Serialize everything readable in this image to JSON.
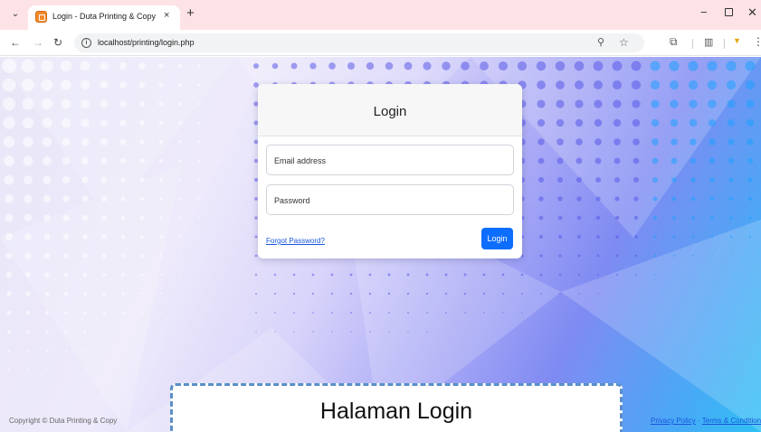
{
  "browser": {
    "tab_title": "Login - Duta Printing & Copy",
    "tab_close": "×",
    "new_tab": "+",
    "url": "localhost/printing/login.php"
  },
  "login": {
    "title": "Login",
    "email_placeholder": "Email address",
    "password_placeholder": "Password",
    "forgot_link": "Forgot Password?",
    "login_button": "Login"
  },
  "footer": {
    "copyright": "Copyright © Duta Printing & Copy",
    "privacy": "Privacy Policy",
    "separator": " · ",
    "terms": "Terms & Conditions"
  },
  "caption": "Halaman Login",
  "colors": {
    "primary": "#0d6efd",
    "tabbar": "#fde3e6",
    "caption_border": "#5a8fc8"
  }
}
